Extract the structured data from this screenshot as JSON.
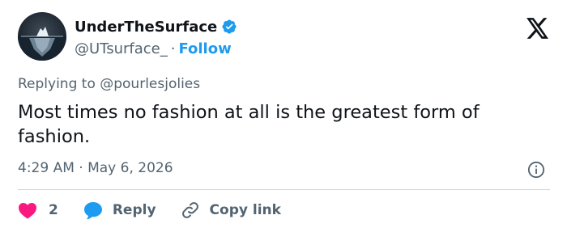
{
  "account": {
    "display_name": "UnderTheSurface",
    "handle": "@UTsurface_",
    "separator": "·",
    "follow_label": "Follow",
    "verified_icon": "verified-badge-icon",
    "avatar_icon": "iceberg-avatar"
  },
  "platform": {
    "logo_icon": "x-logo-icon"
  },
  "tweet": {
    "replying_to": "Replying to @pourlesjolies",
    "text": "Most times no fashion at all is the greatest form of fashion.",
    "timestamp": "4:29 AM · May 6, 2026",
    "info_icon": "info-icon"
  },
  "actions": {
    "like_count": "2",
    "reply_label": "Reply",
    "copy_label": "Copy link"
  },
  "colors": {
    "accent": "#1d9bf0",
    "like": "#f91880",
    "text": "#0f1419",
    "muted": "#536471",
    "divider": "#cfd9de"
  }
}
